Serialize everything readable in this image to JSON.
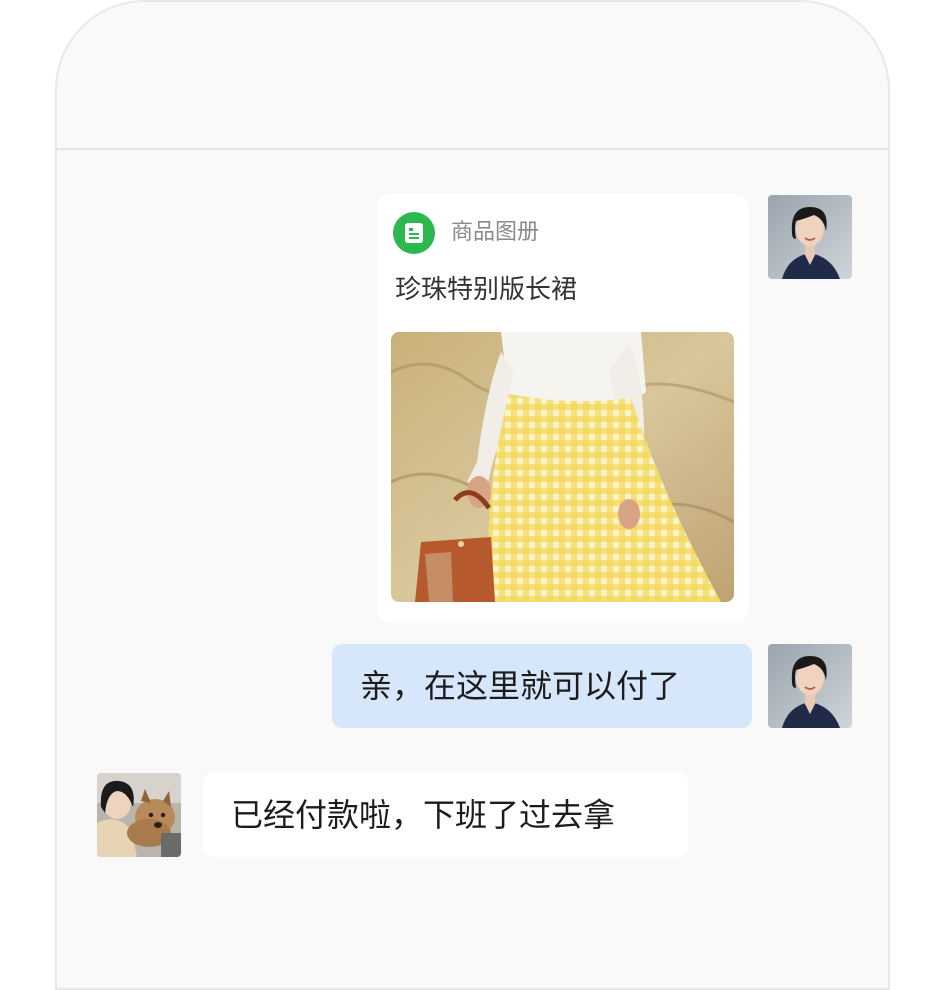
{
  "chat": {
    "messages": [
      {
        "sender": "agent",
        "type": "product-card",
        "source_label": "商品图册",
        "product_title": "珍珠特别版长裙",
        "icon": "catalog-icon"
      },
      {
        "sender": "agent",
        "type": "text",
        "text": "亲，在这里就可以付了"
      },
      {
        "sender": "customer",
        "type": "text",
        "text": "已经付款啦，下班了过去拿"
      }
    ]
  },
  "colors": {
    "outgoing_bubble": "#d6e7fc",
    "incoming_bubble": "#ffffff",
    "catalog_icon": "#2cb84f",
    "background": "#f9f9f9"
  }
}
